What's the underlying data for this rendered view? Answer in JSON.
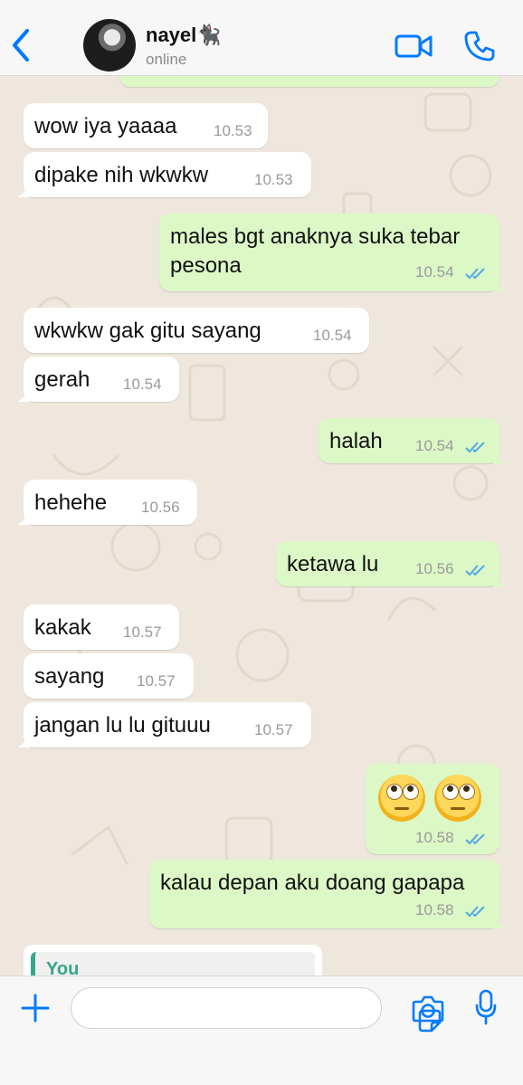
{
  "header": {
    "name": "nayel🐈‍⬛",
    "status": "online"
  },
  "colors": {
    "accent": "#007aff",
    "incoming_bg": "#ffffff",
    "outgoing_bg": "#dcf8c6",
    "read_ticks": "#4fa9e8",
    "reply_accent": "#35a688"
  },
  "messages": [
    {
      "dir": "in",
      "text": "wow iya yaaaa",
      "time": "10.53"
    },
    {
      "dir": "in",
      "text": "dipake nih wkwkw",
      "time": "10.53"
    },
    {
      "dir": "out",
      "text_lines": [
        "males bgt anaknya suka tebar",
        "pesona"
      ],
      "time": "10.54",
      "status": "read"
    },
    {
      "dir": "in",
      "text": "wkwkw gak gitu sayang",
      "time": "10.54"
    },
    {
      "dir": "in",
      "text": "gerah",
      "time": "10.54"
    },
    {
      "dir": "out",
      "text": "halah",
      "time": "10.54",
      "status": "read"
    },
    {
      "dir": "in",
      "text": "hehehe",
      "time": "10.56"
    },
    {
      "dir": "out",
      "text": "ketawa lu",
      "time": "10.56",
      "status": "read"
    },
    {
      "dir": "in",
      "text": "kakak",
      "time": "10.57"
    },
    {
      "dir": "in",
      "text": "sayang",
      "time": "10.57"
    },
    {
      "dir": "in",
      "text": "jangan lu lu gituuu",
      "time": "10.57"
    },
    {
      "dir": "out",
      "emoji": [
        "face-with-rolling-eyes",
        "face-with-rolling-eyes"
      ],
      "time": "10.58",
      "status": "read"
    },
    {
      "dir": "out",
      "text": "kalau depan aku doang gapapa",
      "time": "10.58",
      "status": "read"
    }
  ],
  "reply_preview": {
    "sender": "You"
  },
  "composer": {
    "placeholder": ""
  }
}
